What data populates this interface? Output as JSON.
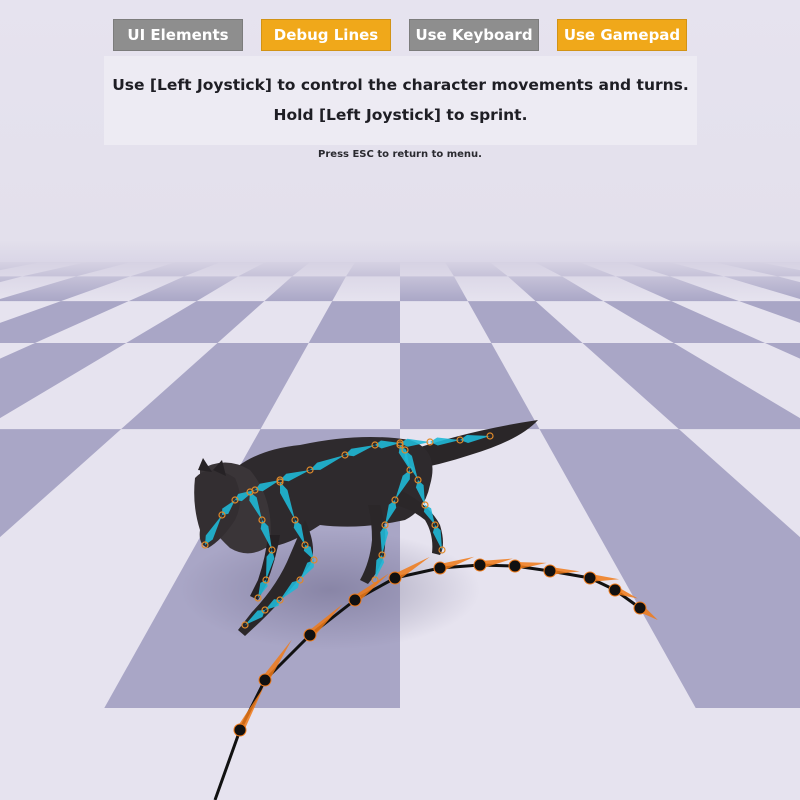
{
  "toolbar": {
    "buttons": [
      {
        "label": "UI Elements",
        "state": "inactive"
      },
      {
        "label": "Debug Lines",
        "state": "active"
      },
      {
        "label": "Use Keyboard",
        "state": "inactive"
      },
      {
        "label": "Use Gamepad",
        "state": "active"
      }
    ]
  },
  "instructions": {
    "line1": "Use [Left Joystick] to control the character movements and turns.",
    "line2": "Hold [Left Joystick] to sprint."
  },
  "hint": {
    "text": "Press ESC to return to menu."
  },
  "colors": {
    "active_button": "#f0a81a",
    "inactive_button": "#8e8e8e",
    "floor_light": "#e6e3ef",
    "floor_dark": "#a9a6c6",
    "bone": "#1fb8d6",
    "trajectory": "#f07a18"
  },
  "scene": {
    "character": "wolf",
    "floor": "checkerboard"
  }
}
